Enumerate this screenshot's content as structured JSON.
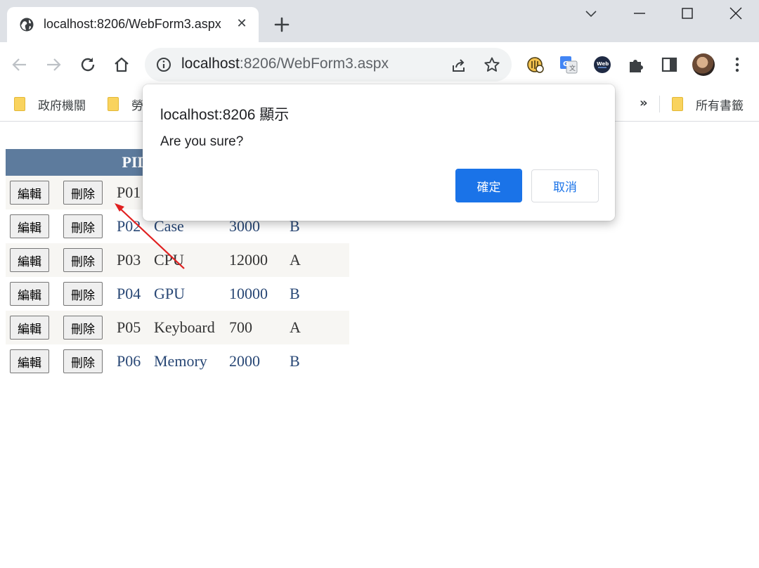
{
  "browser": {
    "tab_title": "localhost:8206/WebForm3.aspx",
    "tab_close": "✕",
    "url_host": "localhost",
    "url_rest": ":8206/WebForm3.aspx"
  },
  "bookmarks": {
    "items": [
      {
        "label": "政府機關"
      },
      {
        "label": "勞"
      }
    ],
    "more": "»",
    "all_bookmarks": "所有書籤"
  },
  "grid": {
    "header": {
      "pid": "PID"
    },
    "edit_label": "編輯",
    "delete_label": "刪除",
    "rows": [
      {
        "pid": "P01",
        "name": "",
        "price": "",
        "grade": ""
      },
      {
        "pid": "P02",
        "name": "Case",
        "price": "3000",
        "grade": "B"
      },
      {
        "pid": "P03",
        "name": "CPU",
        "price": "12000",
        "grade": "A"
      },
      {
        "pid": "P04",
        "name": "GPU",
        "price": "10000",
        "grade": "B"
      },
      {
        "pid": "P05",
        "name": "Keyboard",
        "price": "700",
        "grade": "A"
      },
      {
        "pid": "P06",
        "name": "Memory",
        "price": "2000",
        "grade": "B"
      }
    ]
  },
  "dialog": {
    "title": "localhost:8206 顯示",
    "message": "Are you sure?",
    "ok_label": "確定",
    "cancel_label": "取消"
  },
  "colors": {
    "accent": "#1a73e8",
    "grid_header": "#5d7b9d",
    "grid_alt_row": "#f7f6f3",
    "annotation_arrow": "#e02020"
  }
}
